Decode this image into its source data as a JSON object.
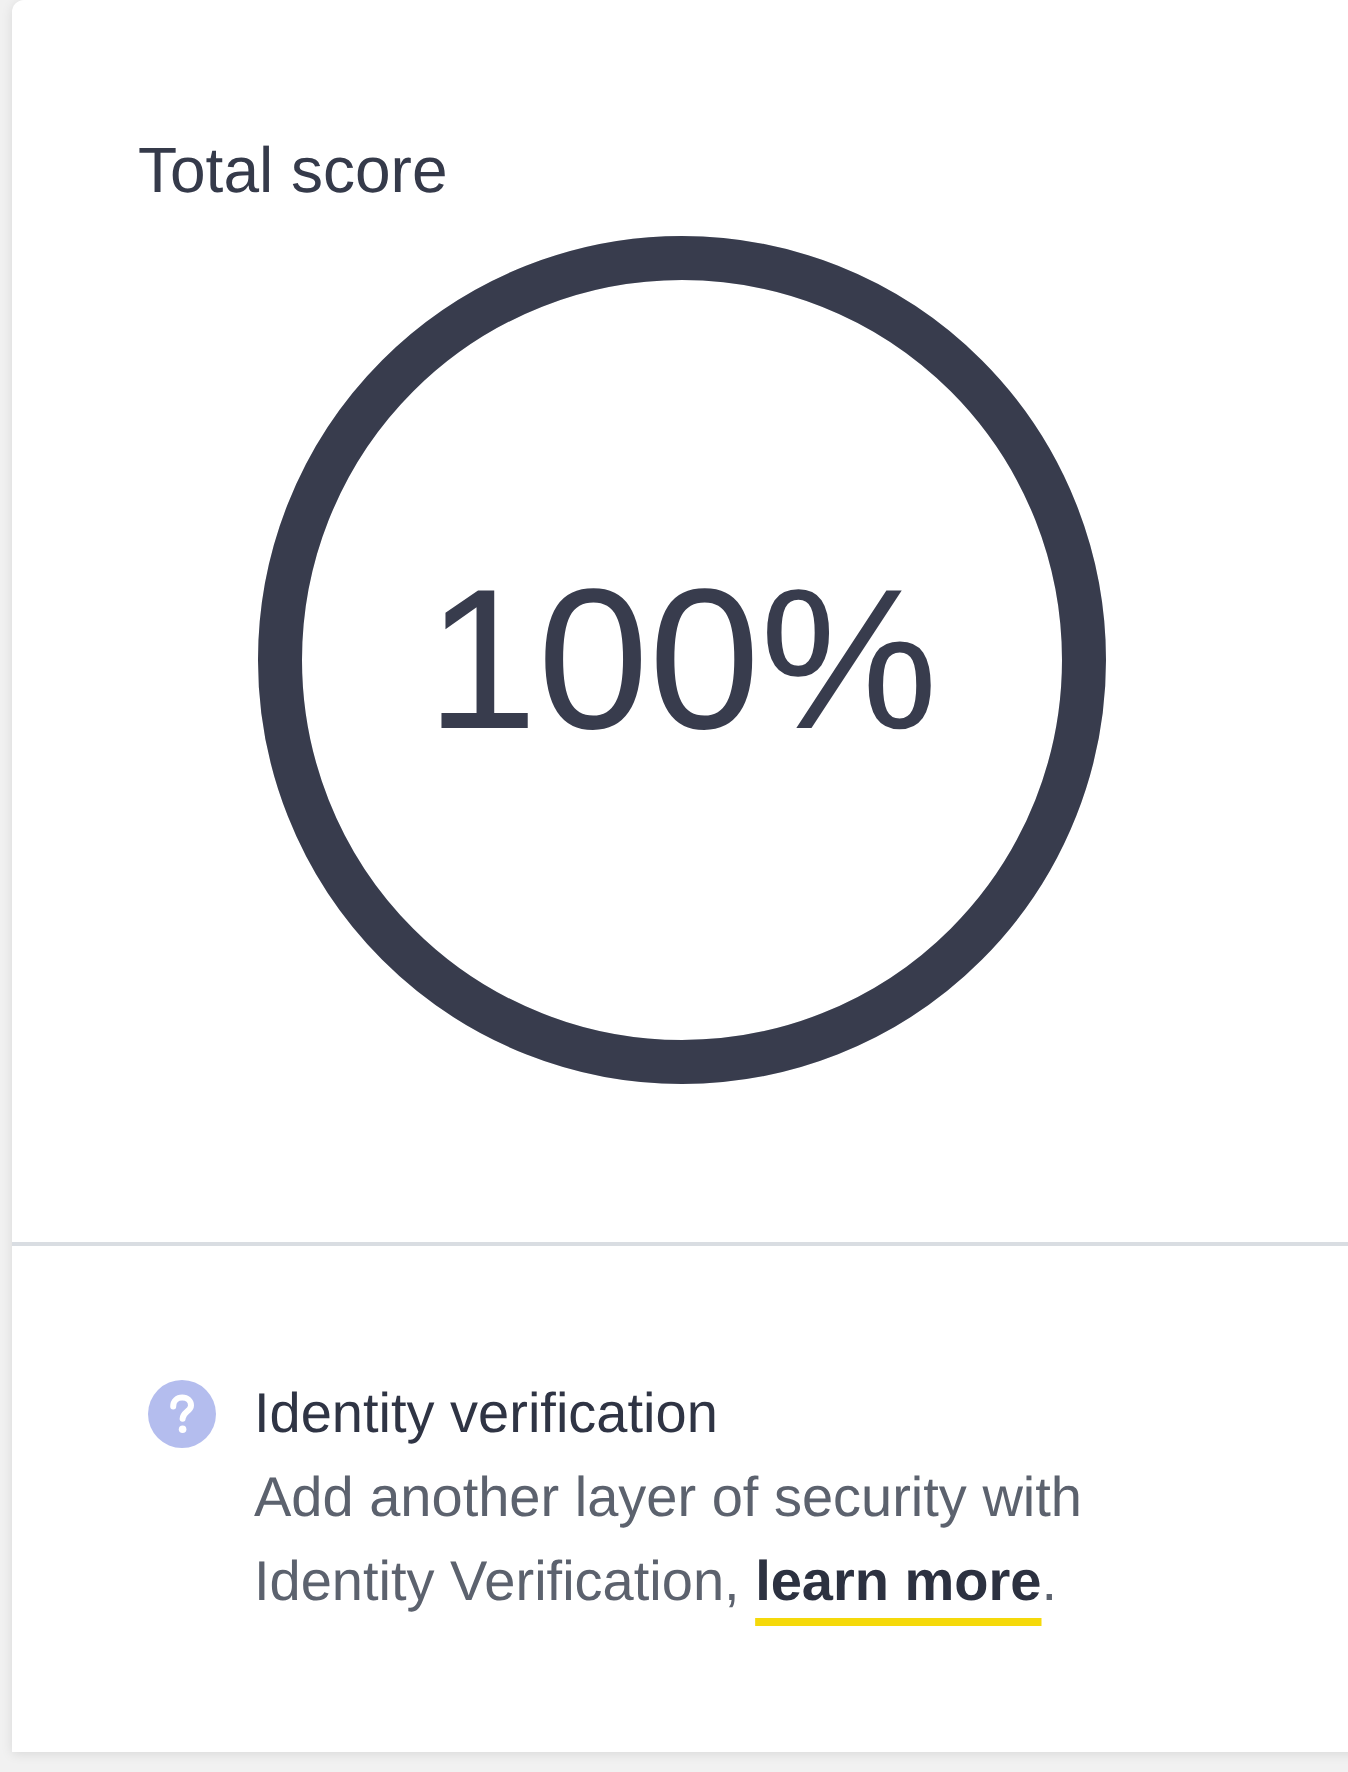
{
  "score": {
    "title": "Total score",
    "value": "100%",
    "level": 1
  },
  "tip": {
    "title": "Identity verification",
    "text": "Add another layer of security with Identity Verification, ",
    "link": "learn more",
    "text_after": "."
  }
}
